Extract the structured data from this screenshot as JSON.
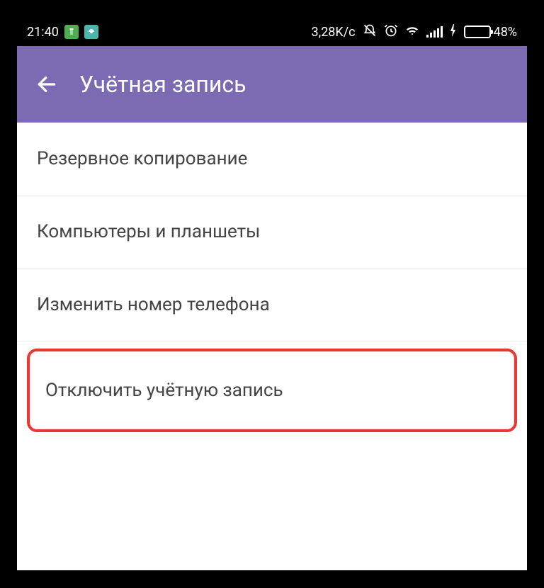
{
  "statusBar": {
    "time": "21:40",
    "dataRate": "3,28K/c",
    "batteryPercent": "48%",
    "batteryFill": 48
  },
  "header": {
    "title": "Учётная запись"
  },
  "settings": {
    "items": [
      {
        "label": "Резервное копирование",
        "highlighted": false
      },
      {
        "label": "Компьютеры и планшеты",
        "highlighted": false
      },
      {
        "label": "Изменить номер телефона",
        "highlighted": false
      },
      {
        "label": "Отключить учётную запись",
        "highlighted": true
      }
    ]
  }
}
